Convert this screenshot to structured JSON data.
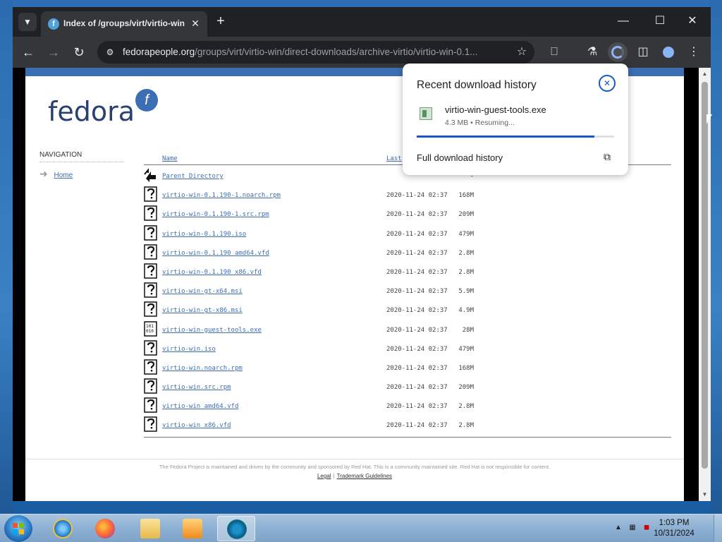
{
  "browser": {
    "tab": {
      "title": "Index of /groups/virt/virtio-win",
      "favicon": "fedora-favicon-icon"
    },
    "url": {
      "host": "fedorapeople.org",
      "path": "/groups/virt/virtio-win/direct-downloads/archive-virtio/virtio-win-0.1..."
    }
  },
  "page": {
    "logo_text": "fedora",
    "navigation": {
      "heading": "NAVIGATION",
      "home": "Home"
    },
    "columns": {
      "name": "Name",
      "last_modified": "Last"
    },
    "rows": [
      {
        "icon": "parent-directory-icon",
        "name": "Parent Directory",
        "date": "",
        "size": "-"
      },
      {
        "icon": "unknown-file-icon",
        "name": "virtio-win-0.1.190-1.noarch.rpm",
        "date": "2020-11-24 02:37",
        "size": "168M"
      },
      {
        "icon": "unknown-file-icon",
        "name": "virtio-win-0.1.190-1.src.rpm",
        "date": "2020-11-24 02:37",
        "size": "209M"
      },
      {
        "icon": "unknown-file-icon",
        "name": "virtio-win-0.1.190.iso",
        "date": "2020-11-24 02:37",
        "size": "479M"
      },
      {
        "icon": "unknown-file-icon",
        "name": "virtio-win-0.1.190_amd64.vfd",
        "date": "2020-11-24 02:37",
        "size": "2.8M"
      },
      {
        "icon": "unknown-file-icon",
        "name": "virtio-win-0.1.190_x86.vfd",
        "date": "2020-11-24 02:37",
        "size": "2.8M"
      },
      {
        "icon": "unknown-file-icon",
        "name": "virtio-win-gt-x64.msi",
        "date": "2020-11-24 02:37",
        "size": "5.9M"
      },
      {
        "icon": "unknown-file-icon",
        "name": "virtio-win-gt-x86.msi",
        "date": "2020-11-24 02:37",
        "size": "4.9M"
      },
      {
        "icon": "binary-file-icon",
        "name": "virtio-win-guest-tools.exe",
        "date": "2020-11-24 02:37",
        "size": "28M"
      },
      {
        "icon": "unknown-file-icon",
        "name": "virtio-win.iso",
        "date": "2020-11-24 02:37",
        "size": "479M"
      },
      {
        "icon": "unknown-file-icon",
        "name": "virtio-win.noarch.rpm",
        "date": "2020-11-24 02:37",
        "size": "168M"
      },
      {
        "icon": "unknown-file-icon",
        "name": "virtio-win.src.rpm",
        "date": "2020-11-24 02:37",
        "size": "209M"
      },
      {
        "icon": "unknown-file-icon",
        "name": "virtio-win_amd64.vfd",
        "date": "2020-11-24 02:37",
        "size": "2.8M"
      },
      {
        "icon": "unknown-file-icon",
        "name": "virtio-win_x86.vfd",
        "date": "2020-11-24 02:37",
        "size": "2.8M"
      }
    ],
    "footer": {
      "text": "The Fedora Project is maintained and driven by the community and sponsored by Red Hat. This is a community maintained site. Red Hat is not responsible for content.",
      "legal": "Legal",
      "separator": "|",
      "trademark": "Trademark Guidelines"
    }
  },
  "download_popup": {
    "title": "Recent download history",
    "filename": "virtio-win-guest-tools.exe",
    "status": "4.3 MB • Resuming...",
    "progress": 0.9,
    "full_history": "Full download history"
  },
  "taskbar": {
    "apps": [
      "internet-explorer-icon",
      "firefox-icon",
      "file-explorer-icon",
      "media-player-icon",
      "chrome-icon"
    ],
    "time": "1:03 PM",
    "date": "10/31/2024"
  },
  "colors": {
    "fedora_blue": "#3c6eb4",
    "fedora_dark": "#294172",
    "chrome_dark": "#202124",
    "accent": "#1a57c6"
  }
}
